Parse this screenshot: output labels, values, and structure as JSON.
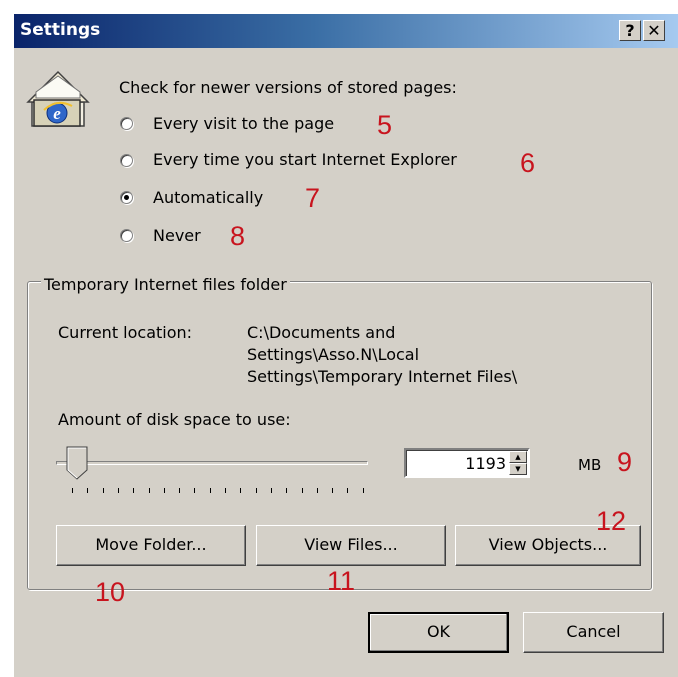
{
  "window": {
    "title": "Settings",
    "help_label": "?",
    "close_label": "✕"
  },
  "check_label": "Check for newer versions of stored pages:",
  "options": [
    {
      "label": "Every visit to the page",
      "checked": false,
      "annotation": "5"
    },
    {
      "label": "Every time you start Internet Explorer",
      "checked": false,
      "annotation": "6"
    },
    {
      "label": "Automatically",
      "checked": true,
      "annotation": "7"
    },
    {
      "label": "Never",
      "checked": false,
      "annotation": "8"
    }
  ],
  "group": {
    "title": "Temporary Internet files folder",
    "location_label": "Current location:",
    "location_lines": [
      "C:\\Documents and",
      "Settings\\Asso.N\\Local",
      "Settings\\Temporary Internet Files\\"
    ],
    "disk_label": "Amount of disk space to use:",
    "disk_value": "1193",
    "disk_unit": "MB",
    "disk_annotation": "9",
    "buttons": [
      {
        "label": "Move Folder...",
        "annotation": "10"
      },
      {
        "label": "View Files...",
        "annotation": "11"
      },
      {
        "label": "View Objects...",
        "annotation": "12"
      }
    ]
  },
  "footer": {
    "ok_label": "OK",
    "cancel_label": "Cancel"
  },
  "icons": {
    "ie": "ie-settings-icon",
    "help": "help-icon",
    "close": "close-icon"
  },
  "colors": {
    "dialog_bg": "#d4d0c8",
    "title_start": "#0a246a",
    "title_end": "#a6caf0",
    "annotation": "#c8141e"
  }
}
